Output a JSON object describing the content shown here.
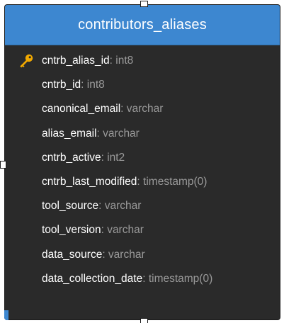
{
  "table": {
    "name": "contributors_aliases",
    "columns": [
      {
        "name": "cntrb_alias_id",
        "type": ": int8",
        "primary_key": true,
        "icon": "key-icon"
      },
      {
        "name": "cntrb_id",
        "type": ": int8",
        "primary_key": false
      },
      {
        "name": "canonical_email",
        "type": ": varchar",
        "primary_key": false
      },
      {
        "name": "alias_email",
        "type": ": varchar",
        "primary_key": false
      },
      {
        "name": "cntrb_active",
        "type": ": int2",
        "primary_key": false
      },
      {
        "name": "cntrb_last_modified",
        "type": ": timestamp(0)",
        "primary_key": false
      },
      {
        "name": "tool_source",
        "type": ": varchar",
        "primary_key": false
      },
      {
        "name": "tool_version",
        "type": ": varchar",
        "primary_key": false
      },
      {
        "name": "data_source",
        "type": ": varchar",
        "primary_key": false
      },
      {
        "name": "data_collection_date",
        "type": ": timestamp(0)",
        "primary_key": false
      }
    ]
  },
  "colors": {
    "header_bg": "#3d87d0",
    "body_bg": "#2a2a2a",
    "column_name": "#ffffff",
    "column_type": "#9a9a9a",
    "key_icon": "#f2a900"
  }
}
